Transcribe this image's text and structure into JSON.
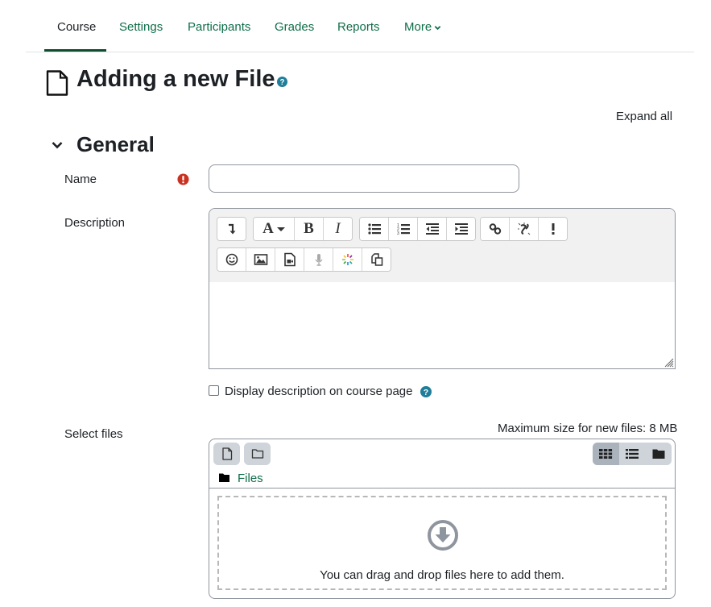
{
  "nav": {
    "items": [
      {
        "label": "Course",
        "active": true
      },
      {
        "label": "Settings",
        "active": false
      },
      {
        "label": "Participants",
        "active": false
      },
      {
        "label": "Grades",
        "active": false
      },
      {
        "label": "Reports",
        "active": false
      },
      {
        "label": "More",
        "active": false,
        "icon": "chevron-down-icon"
      }
    ]
  },
  "page": {
    "title": "Adding a new File",
    "title_icon": "file-icon",
    "help_icon": "question-circle-icon",
    "expand_all": "Expand all"
  },
  "section": {
    "title": "General",
    "collapse_icon": "chevron-down-icon"
  },
  "form": {
    "name": {
      "label": "Name",
      "value": "",
      "required_icon": "exclamation-circle-icon"
    },
    "description": {
      "label": "Description",
      "value": "",
      "toolbar_row1": [
        [
          "collapse"
        ],
        [
          "font-style",
          "bold",
          "italic"
        ],
        [
          "unordered-list",
          "ordered-list",
          "outdent",
          "indent"
        ],
        [
          "link",
          "unlink",
          "accessibility-check"
        ]
      ],
      "toolbar_row2": [
        [
          "emoji",
          "image",
          "media",
          "record-audio",
          "h5p",
          "copy"
        ]
      ],
      "font_button_label": "A",
      "bold_label": "B",
      "italic_label": "I"
    },
    "display_description": {
      "label": "Display description on course page",
      "checked": false
    },
    "select_files": {
      "label": "Select files",
      "max_size": "Maximum size for new files: 8 MB",
      "path_label": "Files",
      "drop_text": "You can drag and drop files here to add them.",
      "view_modes": [
        "icons",
        "list",
        "tree"
      ],
      "active_view": "icons"
    }
  },
  "colors": {
    "link": "#0f6e4a",
    "nav_active_underline": "#0f4d2e",
    "required": "#ca3120",
    "help": "#1f7e9a"
  }
}
